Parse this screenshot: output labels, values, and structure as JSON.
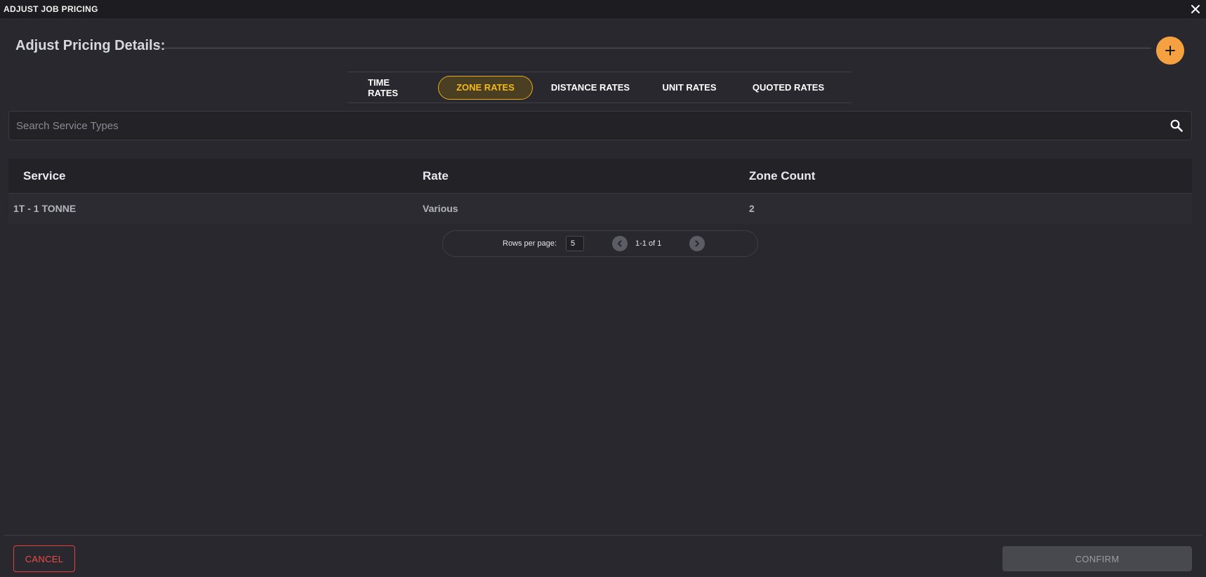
{
  "window": {
    "title": "ADJUST JOB PRICING"
  },
  "heading": "Adjust Pricing Details:",
  "tabs": [
    {
      "label": "TIME RATES",
      "active": false
    },
    {
      "label": "ZONE RATES",
      "active": true
    },
    {
      "label": "DISTANCE RATES",
      "active": false
    },
    {
      "label": "UNIT RATES",
      "active": false
    },
    {
      "label": "QUOTED RATES",
      "active": false
    }
  ],
  "search": {
    "placeholder": "Search Service Types",
    "value": ""
  },
  "table": {
    "headers": [
      "Service",
      "Rate",
      "Zone Count"
    ],
    "rows": [
      [
        "1T - 1 TONNE",
        "Various",
        "2"
      ]
    ]
  },
  "pagination": {
    "rows_label": "Rows per page:",
    "rows_per_page": "5",
    "range": "1-1 of 1"
  },
  "footer": {
    "cancel_label": "CANCEL",
    "confirm_label": "CONFIRM"
  },
  "colors": {
    "accent": "#f5a142",
    "active_tab": "#f5b91a",
    "danger": "#ef4c47",
    "background": "#28282e"
  },
  "icons": {
    "close": "close-icon",
    "add": "plus-icon",
    "search": "search-icon",
    "prev": "chevron-left-icon",
    "next": "chevron-right-icon"
  }
}
